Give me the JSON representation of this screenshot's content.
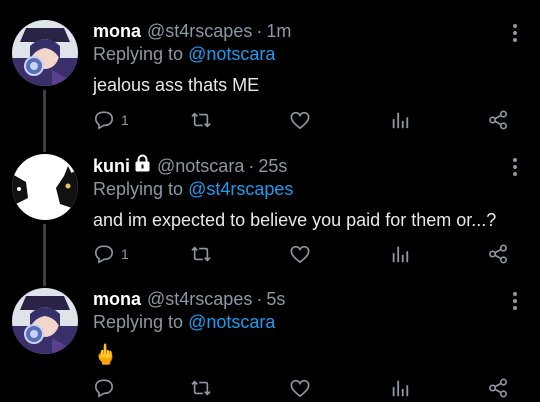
{
  "tweets": [
    {
      "name": "mona",
      "handle": "@st4rscapes",
      "time": "1m",
      "replying_prefix": "Replying to",
      "replying_to": "@notscara",
      "text": "jealous ass thats ME",
      "reply_count": "1",
      "avatar": "anime-character-avatar",
      "locked": false
    },
    {
      "name": "kuni",
      "handle": "@notscara",
      "time": "25s",
      "replying_prefix": "Replying to",
      "replying_to": "@st4rscapes",
      "text": "and im expected to believe you paid for them or...?",
      "reply_count": "1",
      "avatar": "cat-avatar",
      "locked": true
    },
    {
      "name": "mona",
      "handle": "@st4rscapes",
      "time": "5s",
      "replying_prefix": "Replying to",
      "replying_to": "@notscara",
      "text": "🖕",
      "reply_count": "",
      "avatar": "anime-character-avatar",
      "locked": false
    }
  ],
  "separator": "·",
  "colors": {
    "background": "#000000",
    "text": "#e7e9ea",
    "muted": "#8b98a5",
    "link": "#1d9bf0"
  }
}
